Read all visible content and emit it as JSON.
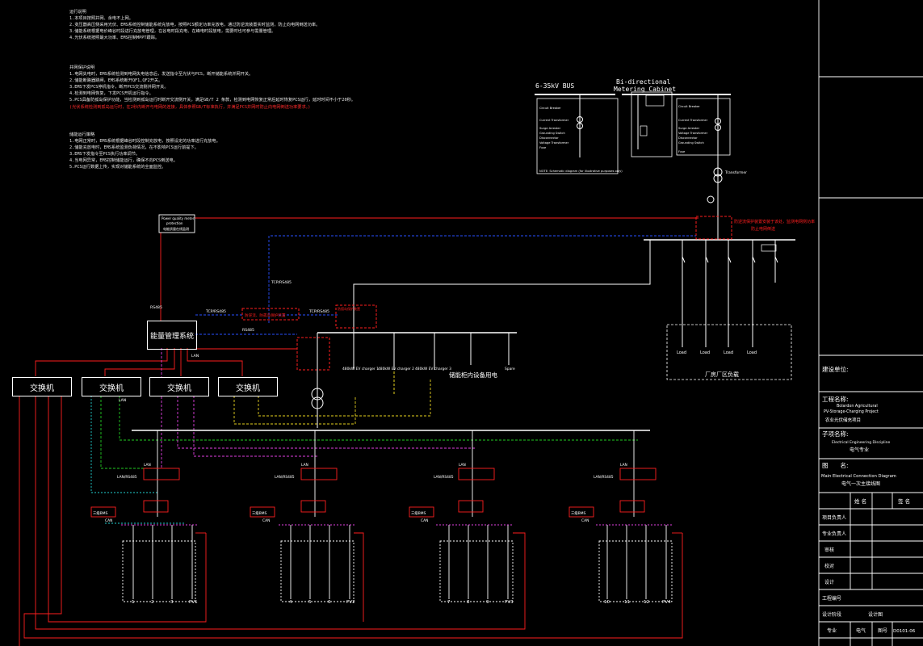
{
  "notes": {
    "block1": [
      "运行说明",
      "1.本项目按照并网、余电不上网。",
      "2.变压器高压侧采用光伏、EMS系统控制储能系统充放电，按照PCS额定功率充放电，通过防逆流装置实时监测，防止向电网倒送功率。",
      "3.储能系统根据电价峰谷时段进行充放电管理，在谷电时段充电、在峰电时段放电，需要时也可参与需量管理。",
      "4.光伏系统按照最大功率、EMS控制MPPT跟踪。"
    ],
    "block2": [
      "并网保护说明",
      "1.电网失电时，EMS系统检测到电网失电信息后，发送指令至光伏与PCS，断开储能系统并网开关。",
      "2.储能断路器跳闸，EMS系统断开QF1,QF2开关。",
      "3.EMS下发PCS停机指令，断开PCS交流侧并网开关。",
      "4.检测到电网恢复，下发PCS开机运行指令。",
      "5.PCS具备防孤岛保护功能，当检测到孤岛运行时断开交流侧开关，满足GB/T 2 条款，检测到电网恢复正常后延时恢复PCS运行，延时时间不小于20秒。"
    ],
    "block2_red": "(光伏系统检测到孤岛运行时，在2秒内断开与电网的连接，具体参照GB/T标准执行，并满足PCS并网时防止向电网倒送功率要求。)",
    "block3": [
      "储能运行策略",
      "1.电网正常时，EMS系统根据峰谷时段控制充放电，按照设定的功率进行充放电。",
      "2.储能充放电时，EMS系统监测负荷情况，在不影响PCS运行前提下。",
      "3.EMS下发指令至PCS执行功率调节。",
      "4.当电网异常，EMS控制储能运行，确保不向PCS倒送电。",
      "5.PCS运行数据上传，实现对储能系统的全面监控。"
    ]
  },
  "top": {
    "bus_label": "6-35kV BUS",
    "metering_title_1": "Bi-directional",
    "metering_title_2": "Metering Cabinet",
    "note": "NOTE: Schematic diagram (for illustrative purposes only)",
    "transformer_label": "Transformer",
    "left_panel": [
      "Circuit Breaker",
      "Current Transformer",
      "Surge Arrester",
      "Grounding Switch",
      "Disconnector",
      "Voltage Transformer",
      "Fuse"
    ],
    "right_panel": [
      "Circuit Breaker",
      "Current Transformer",
      "Surge Arrester",
      "Voltage Transformer",
      "Disconnector",
      "Grounding Switch",
      "Fuse"
    ],
    "red_note_1": "防逆流保护装置安装于该处，监测电网侧功率",
    "red_note_2": "防止电网倒送",
    "loads": [
      "Load",
      "Load",
      "Load",
      "Load"
    ],
    "plant_load_label": "厂房厂区负载"
  },
  "control": {
    "power_quality_box": "Power quality meter\nprotection\n电能质量在线监测",
    "ems_label": "能量管理系统",
    "switches": [
      "交换机",
      "交换机",
      "交换机",
      "交换机"
    ],
    "red_box_label": "防逆流、防孤岛保护装置",
    "red_box_small": "防孤岛保护装置",
    "labels": {
      "rs485": "RS485",
      "lan": "LAN",
      "tcp1": "TCP/RS485",
      "tcp2": "TCP/RS485",
      "rs485_2": "RS485",
      "tcp3": "TCP/RS485",
      "lan_ems": "LAN",
      "lan_rs485": "LAN/RS485"
    },
    "ev_feeders": [
      "480kW EV charger 1",
      "480kW EV charger 2",
      "480kW EV charger 3",
      "Spare"
    ],
    "feeder_bus_label": "储能柜内设备用电",
    "small_label": "储能变压器"
  },
  "units": [
    {
      "bat": [
        "1",
        "2",
        "3"
      ],
      "pv": "PV1"
    },
    {
      "bat": [
        "4",
        "5",
        "6"
      ],
      "pv": "PV2"
    },
    {
      "bat": [
        "7",
        "8",
        "9"
      ],
      "pv": "PV3"
    },
    {
      "bat": [
        "10",
        "11",
        "12"
      ],
      "pv": "PV4"
    }
  ],
  "unit_labels": {
    "lan": "LAN",
    "lanrs": "LAN/RS485",
    "bms": "三级BMS",
    "can": "CAN",
    "tfc": "TFC"
  },
  "titleblock": {
    "build_unit": "建设单位:",
    "project_name": "工程名称:",
    "project_en_1": "Bolardon Agricultural",
    "project_en_2": "PV-Storage-Charging Project",
    "project_cn": "农业光伏储充项目",
    "sub_name": "子项名称:",
    "sub_en": "Electrical Engineering Discipline",
    "sub_cn": "电气专业",
    "drawing_name": "图　　名:",
    "drawing_en": "Main Electrical Connection Diagram",
    "drawing_cn": "电气一次主接线图",
    "col_name": "姓 名",
    "col_sign": "签 名",
    "roles": [
      "项目负责人",
      "专业负责人",
      "审核",
      "校对",
      "设计",
      "工程编号",
      "设计阶段"
    ],
    "design_stage": "设计图",
    "discipline": "专业",
    "discipline_val": "电气",
    "drawing_no_label": "图号",
    "drawing_no": "D0101-06"
  },
  "colors": {
    "red": "#ff1e1e",
    "blue": "#2850ff",
    "green": "#22cc22",
    "yellow": "#e6d21e",
    "magenta": "#e040e0",
    "cyan": "#22d0d0",
    "white": "#ffffff"
  }
}
